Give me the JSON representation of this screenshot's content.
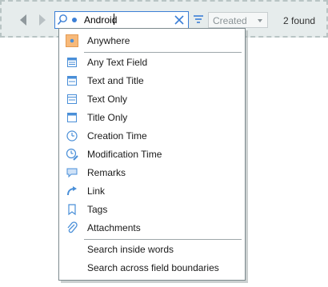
{
  "toolbar": {
    "search": {
      "value": "Android"
    },
    "sort": {
      "selected": "Created"
    },
    "result_count": "2 found"
  },
  "menu": {
    "items": [
      {
        "label": "Anywhere",
        "icon": "anywhere-icon"
      },
      {
        "label": "Any Text Field",
        "icon": "text-field-icon"
      },
      {
        "label": "Text and Title",
        "icon": "text-title-icon"
      },
      {
        "label": "Text Only",
        "icon": "text-only-icon"
      },
      {
        "label": "Title Only",
        "icon": "title-only-icon"
      },
      {
        "label": "Creation Time",
        "icon": "clock-icon"
      },
      {
        "label": "Modification Time",
        "icon": "clock-edit-icon"
      },
      {
        "label": "Remarks",
        "icon": "speech-bubble-icon"
      },
      {
        "label": "Link",
        "icon": "link-icon"
      },
      {
        "label": "Tags",
        "icon": "tag-icon"
      },
      {
        "label": "Attachments",
        "icon": "paperclip-icon"
      }
    ],
    "options": [
      {
        "label": "Search inside words"
      },
      {
        "label": "Search across field boundaries"
      }
    ]
  },
  "colors": {
    "accent": "#3c7fd6",
    "icon_blue": "#4a8fd8",
    "selected_bg": "#f7b97a"
  }
}
